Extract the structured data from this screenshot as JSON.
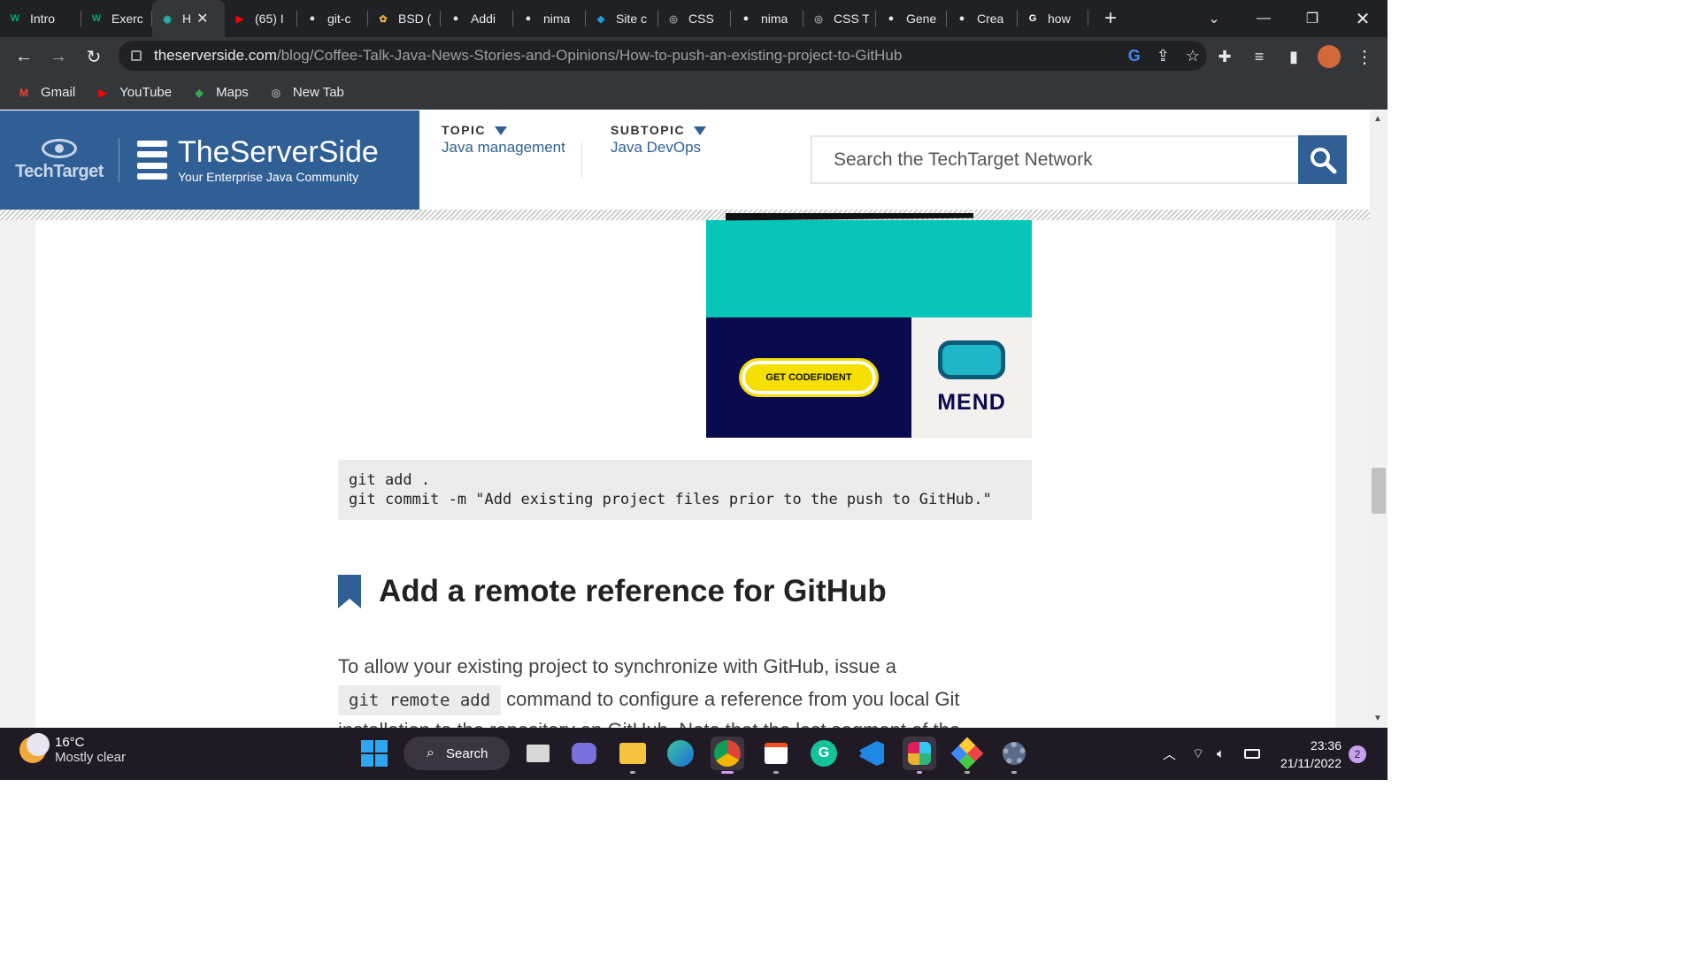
{
  "browser": {
    "tabs": [
      {
        "title": "Intro",
        "favicon": "w3schools-icon",
        "color": "#04aa6d",
        "glyph": "W",
        "w": 92
      },
      {
        "title": "Exerc",
        "favicon": "w3schools-icon",
        "color": "#04aa6d",
        "glyph": "W",
        "w": 80
      },
      {
        "title": "H",
        "favicon": "techtarget-icon",
        "color": "#2bb3a7",
        "glyph": "◉",
        "active": true,
        "w": 82
      },
      {
        "title": "(65) I",
        "favicon": "youtube-icon",
        "color": "#ff0000",
        "glyph": "▶",
        "w": 82
      },
      {
        "title": "git-c",
        "favicon": "github-icon",
        "color": "#e8eaed",
        "glyph": "●",
        "w": 80
      },
      {
        "title": "BSD (",
        "favicon": "bsd-icon",
        "color": "#f0b43a",
        "glyph": "✿",
        "w": 82
      },
      {
        "title": "Addi",
        "favicon": "github-icon",
        "color": "#e8eaed",
        "glyph": "●",
        "w": 82
      },
      {
        "title": "nima",
        "favicon": "github-icon",
        "color": "#e8eaed",
        "glyph": "●",
        "w": 82
      },
      {
        "title": "Site c",
        "favicon": "diamond-icon",
        "color": "#1aa0d8",
        "glyph": "◆",
        "w": 82
      },
      {
        "title": "CSS",
        "favicon": "globe-icon",
        "color": "#9aa0a6",
        "glyph": "◎",
        "w": 82
      },
      {
        "title": "nima",
        "favicon": "github-icon",
        "color": "#e8eaed",
        "glyph": "●",
        "w": 82
      },
      {
        "title": "CSS T",
        "favicon": "globe-icon",
        "color": "#9aa0a6",
        "glyph": "◎",
        "w": 82
      },
      {
        "title": "Gene",
        "favicon": "github-icon",
        "color": "#e8eaed",
        "glyph": "●",
        "w": 80
      },
      {
        "title": "Crea",
        "favicon": "github-icon",
        "color": "#e8eaed",
        "glyph": "●",
        "w": 80
      },
      {
        "title": "how",
        "favicon": "google-icon",
        "color": "#ffffff",
        "glyph": "G",
        "w": 80
      }
    ],
    "tab_close": "✕",
    "new_tab": "+",
    "url_host": "theserverside.com",
    "url_path": "/blog/Coffee-Talk-Java-News-Stories-and-Opinions/How-to-push-an-existing-project-to-GitHub",
    "bookmarks": [
      {
        "label": "Gmail",
        "icon": "gmail-icon",
        "color": "#ea4335",
        "glyph": "M"
      },
      {
        "label": "YouTube",
        "icon": "youtube-icon",
        "color": "#ff0000",
        "glyph": "▶"
      },
      {
        "label": "Maps",
        "icon": "maps-icon",
        "color": "#34a853",
        "glyph": "◆"
      },
      {
        "label": "New Tab",
        "icon": "globe-icon",
        "color": "#9aa0a6",
        "glyph": "◎"
      }
    ]
  },
  "site": {
    "techtarget": "TechTarget",
    "name": "TheServerSide",
    "tagline": "Your Enterprise Java Community",
    "topic_label": "TOPIC",
    "topic_value": "Java management",
    "subtopic_label": "SUBTOPIC",
    "subtopic_value": "Java DevOps",
    "search_placeholder": "Search the TechTarget Network",
    "brand_color": "#2f5f95"
  },
  "ad": {
    "cta": "GET CODEFIDENT",
    "brand": "MEND"
  },
  "article": {
    "code_line1": "git add .",
    "code_line2": "git commit -m \"Add existing project files prior to the push to GitHub.\"",
    "heading": "Add a remote reference for GitHub",
    "para_a": "To allow your existing project to synchronize with GitHub, issue a",
    "para_code": "git remote add",
    "para_b": "command to configure a reference from you local Git",
    "para_c": "installation to the repository on GitHub. Note that the last segment of the"
  },
  "taskbar": {
    "temp": "16°C",
    "weather": "Mostly clear",
    "search": "Search",
    "time": "23:36",
    "date": "21/11/2022",
    "notifications": "2"
  }
}
